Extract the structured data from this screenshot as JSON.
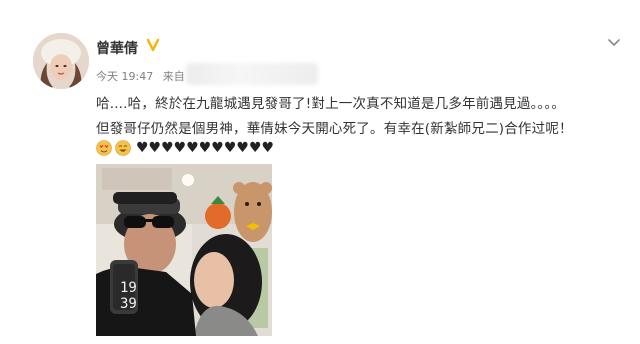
{
  "user": {
    "name": "曾華倩",
    "time": "今天 19:47",
    "source_prefix": "来自"
  },
  "post": {
    "line1": "哈....哈，終於在九龍城遇見發哥了!對上一次真不知道是几多年前遇見過。。。。",
    "line2": "但發哥仔仍然是個男神，華倩妹今天開心死了。有幸在(新紮師兄二)合作过呢！",
    "hearts": "♥♥♥♥♥♥♥♥♥♥♥"
  },
  "photo": {
    "watch_time": "19\n39"
  },
  "icons": {
    "verified": "verified-badge-icon",
    "menu": "chevron-down-icon"
  },
  "colors": {
    "verified": "#f7b500",
    "name": "#333333",
    "meta": "#808080"
  }
}
